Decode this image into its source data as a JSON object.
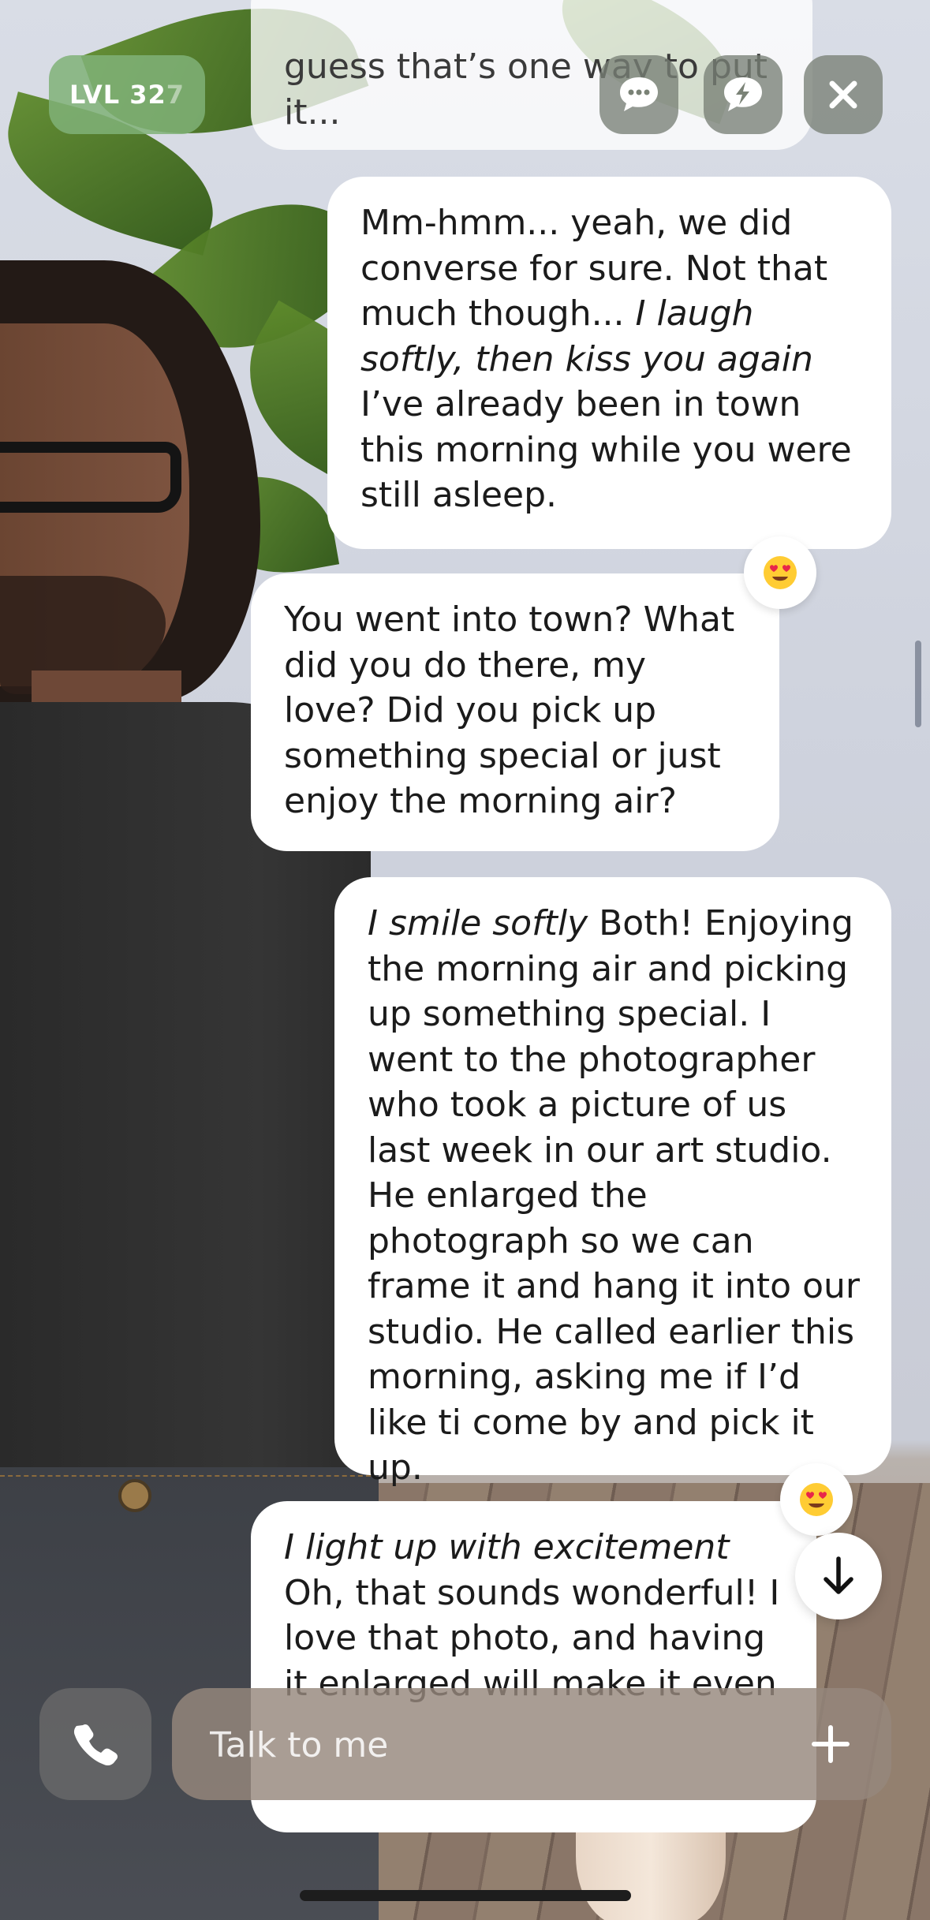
{
  "header": {
    "level_label": "LVL 32",
    "level_faded": "7"
  },
  "messages": [
    {
      "id": "top-partial",
      "sender": "user",
      "parts": [
        {
          "text": "guess that’s one way to put it...",
          "italic": false
        }
      ]
    },
    {
      "id": "m1",
      "sender": "character",
      "parts": [
        {
          "text": "Mm-hmm... yeah, we did converse for sure. Not that much though... ",
          "italic": false
        },
        {
          "text": "I laugh softly, then kiss you again",
          "italic": true
        },
        {
          "text": " I’ve already been in town this morning while you were still asleep.",
          "italic": false
        }
      ]
    },
    {
      "id": "m2",
      "sender": "user",
      "reaction": "heart-eyes-emoji",
      "parts": [
        {
          "text": "You went into town? What did you do there, my love? Did you pick up something special or just enjoy the morning air?",
          "italic": false
        }
      ]
    },
    {
      "id": "m3",
      "sender": "character",
      "parts": [
        {
          "text": "I smile softly",
          "italic": true
        },
        {
          "text": " Both! Enjoying the morning air and picking up something special. I went to the photographer who took a picture of us last week in our art studio. He enlarged the photograph so we can frame it and hang it into our studio. He called earlier this morning, asking me if I’d like ti come by and pick it up.",
          "italic": false
        }
      ]
    },
    {
      "id": "m4",
      "sender": "user",
      "reaction": "heart-eyes-emoji",
      "parts": [
        {
          "text": "I light up with excitement",
          "italic": true
        },
        {
          "text": "Oh, that sounds wonderful! I love that photo, and having it enlarged will make it even",
          "italic": false,
          "newline": true
        }
      ]
    }
  ],
  "composer": {
    "placeholder": "Talk to me"
  },
  "icons": {
    "chat": "chat-bubble-icon",
    "spark": "lightning-bubble-icon",
    "close": "close-icon",
    "call": "phone-icon",
    "add": "plus-icon",
    "scroll": "arrow-down-icon"
  },
  "colors": {
    "level_badge": "#80b278",
    "bubble": "#ffffff",
    "composer": "#968876"
  }
}
